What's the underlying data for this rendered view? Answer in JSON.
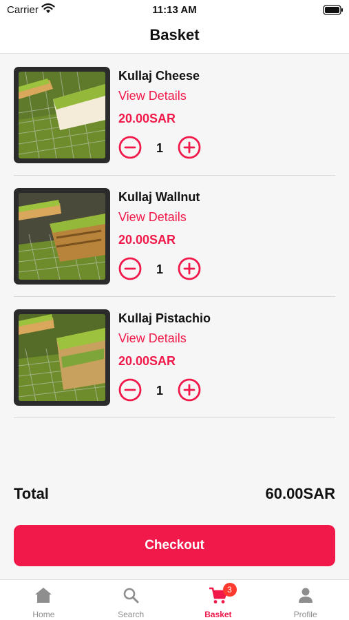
{
  "status_bar": {
    "carrier": "Carrier",
    "time": "11:13 AM"
  },
  "header": {
    "title": "Basket"
  },
  "items": [
    {
      "name": "Kullaj Cheese",
      "details_label": "View Details",
      "price": "20.00SAR",
      "quantity": "1"
    },
    {
      "name": "Kullaj Wallnut",
      "details_label": "View Details",
      "price": "20.00SAR",
      "quantity": "1"
    },
    {
      "name": "Kullaj Pistachio",
      "details_label": "View Details",
      "price": "20.00SAR",
      "quantity": "1"
    }
  ],
  "summary": {
    "total_label": "Total",
    "total_value": "60.00SAR"
  },
  "checkout_label": "Checkout",
  "tabs": [
    {
      "label": "Home",
      "icon": "home-icon"
    },
    {
      "label": "Search",
      "icon": "search-icon"
    },
    {
      "label": "Basket",
      "icon": "cart-icon",
      "badge": "3",
      "active": true
    },
    {
      "label": "Profile",
      "icon": "person-icon"
    }
  ],
  "colors": {
    "accent": "#f0194a",
    "badge": "#ff3b30"
  }
}
